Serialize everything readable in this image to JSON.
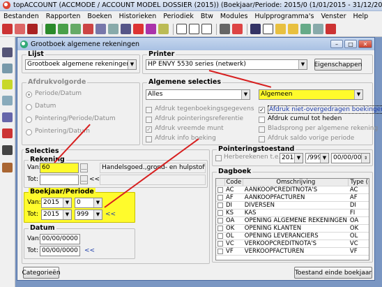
{
  "app": {
    "title": "topACCOUNT (ACCMODE / ACCOUNT MODEL DOSSIER (2015)) (Boekjaar/Periode: 2015/0 (1/01/2015 - 31/12/2015)]"
  },
  "menu": [
    "Bestanden",
    "Rapporten",
    "Boeken",
    "Historieken",
    "Periodiek",
    "Btw",
    "Modules",
    "Hulpprogramma's",
    "Venster",
    "Help"
  ],
  "dialog": {
    "title": "Grootboek algemene rekeningen",
    "lijst": {
      "legend": "Lijst",
      "value": "Grootboek algemene rekeningen"
    },
    "printer": {
      "legend": "Printer",
      "value": "HP ENVY 5530 series (netwerk)",
      "eigenschappen": "Eigenschappen"
    },
    "afdrukvolgorde": {
      "legend": "Afdrukvolgorde",
      "options": [
        "Periode/Datum",
        "Datum",
        "Pointering/Periode/Datum",
        "Pointering/Datum"
      ]
    },
    "algemene_selecties": {
      "legend": "Algemene selecties",
      "left_combo": "Alles",
      "right_combo": "Algemeen",
      "checks_left": [
        "Afdruk tegenboekingsgegevens",
        "Afdruk pointeringsreferentie",
        "Afdruk vreemde munt",
        "Afdruk info boeking"
      ],
      "checks_right": [
        "Afdruk niet-overgedragen boekingen",
        "Afdruk cumul tot heden",
        "Bladsprong per algemene rekening",
        "Afdruk saldo vorige periode"
      ]
    },
    "selecties": {
      "legend": "Selecties",
      "rekening": {
        "legend": "Rekening",
        "van_label": "Van:",
        "van_value": "60",
        "tot_label": "Tot:",
        "tot_value": "",
        "description": "Handelsgoed.,grond- en hulpstoffen",
        "back": "<<"
      },
      "boekjaar": {
        "legend": "Boekjaar/Periode",
        "van_label": "Van:",
        "van_year": "2015",
        "van_period": "0",
        "tot_label": "Tot:",
        "tot_year": "2015",
        "tot_period": "999",
        "back": "<<"
      },
      "datum": {
        "legend": "Datum",
        "van_label": "Van:",
        "van_value": "00/00/0000",
        "tot_label": "Tot:",
        "tot_value": "00/00/0000",
        "back": "<<"
      }
    },
    "pointeringstoestand": {
      "legend": "Pointeringstoestand",
      "check_label": "Herberekenen t.e.m.",
      "year": "2018",
      "period": "/999",
      "date": "00/00/0000"
    },
    "dagboek": {
      "legend": "Dagboek",
      "headers": [
        "Code",
        "Omschrijving",
        "Type (+"
      ],
      "rows": [
        {
          "code": "AC",
          "omschrijving": "AANKOOPCREDITNOTA'S",
          "type": "AC"
        },
        {
          "code": "AF",
          "omschrijving": "AANKOOPFACTUREN",
          "type": "AF"
        },
        {
          "code": "DI",
          "omschrijving": "DIVERSEN",
          "type": "DI"
        },
        {
          "code": "KS",
          "omschrijving": "KAS",
          "type": "FI"
        },
        {
          "code": "OA",
          "omschrijving": "OPENING ALGEMENE REKENINGEN",
          "type": "OA"
        },
        {
          "code": "OK",
          "omschrijving": "OPENING KLANTEN",
          "type": "OK"
        },
        {
          "code": "OL",
          "omschrijving": "OPENING LEVERANCIERS",
          "type": "OL"
        },
        {
          "code": "VC",
          "omschrijving": "VERKOOPCREDITNOTA'S",
          "type": "VC"
        },
        {
          "code": "VF",
          "omschrijving": "VERKOOPFACTUREN",
          "type": "VF"
        }
      ]
    },
    "buttons": {
      "categorieen": "Categorieën",
      "toestand": "Toestand einde boekjaar"
    }
  }
}
